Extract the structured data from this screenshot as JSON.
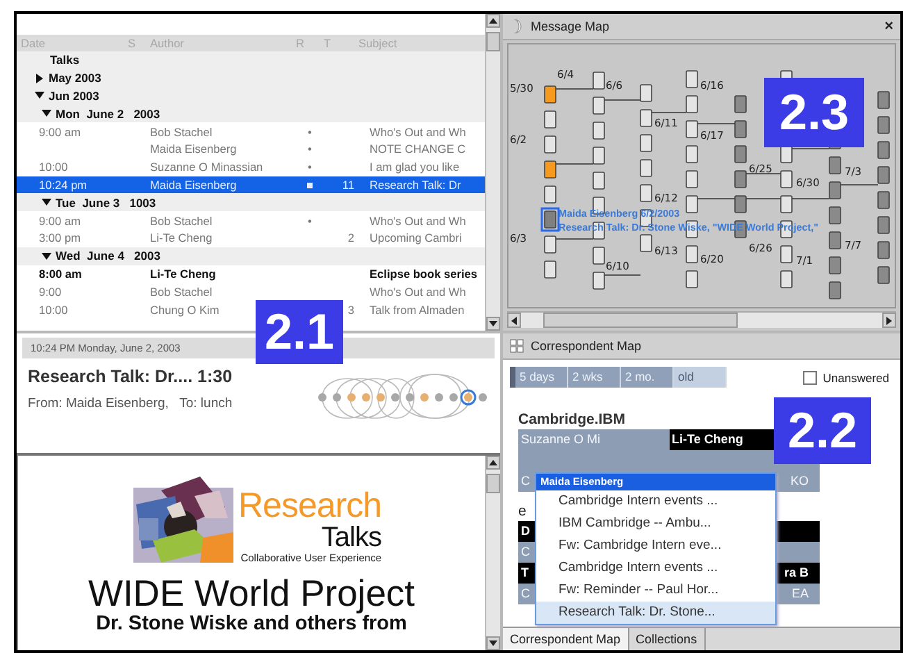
{
  "callouts": [
    {
      "label": "2.1"
    },
    {
      "label": "2.2"
    },
    {
      "label": "2.3"
    }
  ],
  "thread_list": {
    "columns": [
      "Date",
      "S",
      "Author",
      "R",
      "T",
      "Subject"
    ],
    "rows": [
      {
        "kind": "root",
        "label": "Talks",
        "children": [
          {
            "kind": "group",
            "label": "May 2003",
            "expanded": false
          },
          {
            "kind": "group",
            "label": "Jun 2003",
            "expanded": true,
            "children": [
              {
                "kind": "group",
                "label": "Mon  June 2   2003",
                "expanded": true,
                "children": [
                  {
                    "kind": "message",
                    "time": "9:00 am",
                    "author": "Bob Stachel",
                    "mark": "•",
                    "subject": "Who's Out and Wh",
                    "bold": false,
                    "selected": false
                  },
                  {
                    "kind": "message",
                    "author": "Maida Eisenberg",
                    "mark": "•",
                    "subject": "NOTE CHANGE C",
                    "bold": false,
                    "selected": false
                  },
                  {
                    "kind": "message",
                    "time": "10:00",
                    "author": "Suzanne O Minassian",
                    "mark": "•",
                    "subject": "I am glad you like",
                    "bold": false,
                    "selected": false
                  },
                  {
                    "kind": "message",
                    "time": "10:24 pm",
                    "author": "Maida Eisenberg",
                    "mark": "■",
                    "count": "11",
                    "subject": "Research Talk: Dr",
                    "bold": false,
                    "selected": true
                  }
                ]
              },
              {
                "kind": "group",
                "label": "Tue  June 3   1003",
                "expanded": true,
                "children": [
                  {
                    "kind": "message",
                    "time": "9:00 am",
                    "author": "Bob Stachel",
                    "mark": "•",
                    "subject": "Who's Out and Wh",
                    "bold": false,
                    "selected": false
                  },
                  {
                    "kind": "message",
                    "time": "3:00 pm",
                    "author": "Li-Te Cheng",
                    "count": "2",
                    "subject": "Upcoming Cambri",
                    "bold": false,
                    "selected": false
                  }
                ]
              },
              {
                "kind": "group",
                "label": "Wed  June 4   2003",
                "expanded": true,
                "children": [
                  {
                    "kind": "message",
                    "time": "8:00 am",
                    "author": "Li-Te Cheng",
                    "subject": "Eclipse book series",
                    "bold": true,
                    "selected": false
                  },
                  {
                    "kind": "message",
                    "time": "9:00",
                    "author": "Bob Stachel",
                    "subject": "Who's Out and Wh",
                    "bold": false,
                    "selected": false
                  },
                  {
                    "kind": "message",
                    "time": "10:00",
                    "author": "Chung O Kim",
                    "count": "3",
                    "subject": "Talk from Almaden",
                    "bold": false,
                    "selected": false
                  }
                ]
              }
            ]
          }
        ]
      }
    ]
  },
  "message_view": {
    "date": "10:24 PM Monday, June 2, 2003",
    "subject": "Research Talk: Dr.... 1:30",
    "from": "From: Maida Eisenberg,   To: lunch",
    "body": {
      "logo_title": "Research",
      "logo_subtitle": "Talks",
      "logo_tagline": "Collaborative User Experience",
      "heading": "WIDE World Project",
      "subheading": "Dr. Stone Wiske and others from"
    }
  },
  "message_map": {
    "title": "Message Map",
    "close": "×",
    "date_labels": [
      "5/30",
      "6/4",
      "6/6",
      "6/16",
      "6/2",
      "6/11",
      "6/17",
      "6/25",
      "6/30",
      "7/3",
      "6/12",
      "6/3",
      "6/13",
      "6/20",
      "6/26",
      "7/1",
      "7/7",
      "6/10"
    ],
    "tooltip": {
      "author_date": "Maida Eisenberg  6/2/2003",
      "subject": "Research Talk: Dr. Stone Wiske, \"WIDE World Project,\""
    }
  },
  "correspondent_map": {
    "title": "Correspondent Map",
    "time_tabs": [
      {
        "label": "5 days",
        "selected": true
      },
      {
        "label": "2 wks",
        "selected": true
      },
      {
        "label": "2 mo.",
        "selected": true
      },
      {
        "label": "old",
        "selected": false
      }
    ],
    "unanswered": {
      "label": "Unanswered",
      "checked": false
    },
    "groups": [
      {
        "label": "Cambridge.IBM",
        "rows": [
          {
            "left": {
              "text": "Suzanne O Mi",
              "dark": false
            },
            "right": {
              "text": "Li-Te Cheng",
              "dark": true
            }
          },
          {
            "left": {
              "dark": false
            },
            "right": {
              "dark": false
            }
          },
          {
            "left": {
              "text": "C",
              "dark": false
            },
            "right": {
              "text": "KO",
              "dark": false
            }
          }
        ]
      },
      {
        "label": "e",
        "rows": [
          {
            "left": {
              "text": "D",
              "dark": true
            },
            "right": {
              "dark": true
            }
          },
          {
            "left": {
              "text": "C",
              "dark": false
            },
            "right": {
              "dark": false
            }
          },
          {
            "left": {
              "text": "T",
              "dark": true
            },
            "right": {
              "text": "ra B",
              "dark": true
            }
          },
          {
            "left": {
              "text": "C",
              "dark": false
            },
            "right": {
              "text": "EA",
              "dark": false
            }
          }
        ]
      }
    ],
    "popup": {
      "title": "Maida Eisenberg",
      "items": [
        {
          "label": "Cambridge Intern events ...",
          "selected": false
        },
        {
          "label": "IBM Cambridge -- Ambu...",
          "selected": false
        },
        {
          "label": "Fw: Cambridge Intern eve...",
          "selected": false
        },
        {
          "label": "Cambridge Intern events ...",
          "selected": false
        },
        {
          "label": "Fw: Reminder -- Paul Hor...",
          "selected": false
        },
        {
          "label": "Research Talk: Dr. Stone...",
          "selected": true
        }
      ]
    },
    "bottom_tabs": [
      {
        "label": "Correspondent Map",
        "selected": true
      },
      {
        "label": "Collections",
        "selected": false
      }
    ]
  }
}
